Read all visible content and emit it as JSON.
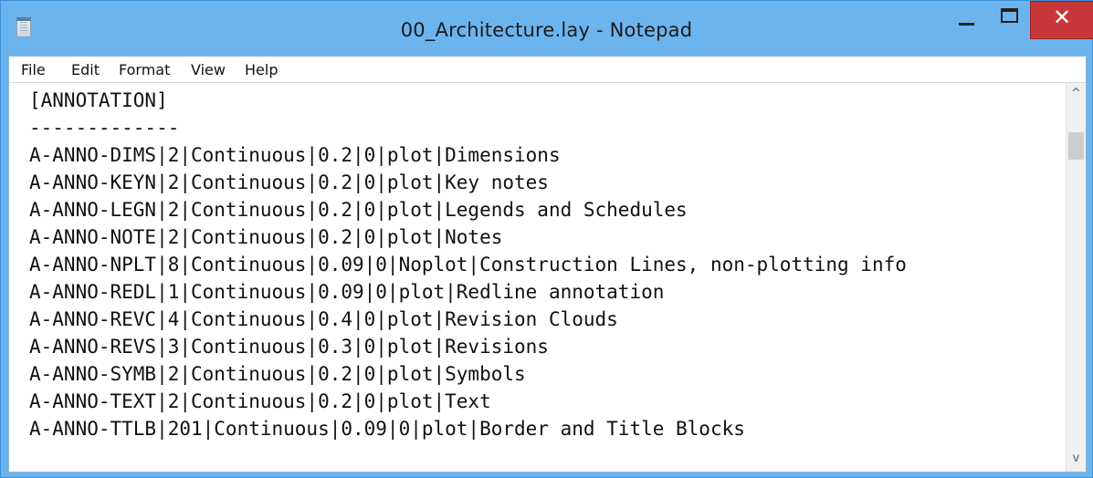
{
  "window": {
    "title": "00_Architecture.lay - Notepad",
    "close_glyph": "✕"
  },
  "menubar": {
    "items": [
      "File",
      "Edit",
      "Format",
      "View",
      "Help"
    ]
  },
  "editor": {
    "lines": [
      "[ANNOTATION]",
      "-------------",
      "A-ANNO-DIMS|2|Continuous|0.2|0|plot|Dimensions",
      "A-ANNO-KEYN|2|Continuous|0.2|0|plot|Key notes",
      "A-ANNO-LEGN|2|Continuous|0.2|0|plot|Legends and Schedules",
      "A-ANNO-NOTE|2|Continuous|0.2|0|plot|Notes",
      "A-ANNO-NPLT|8|Continuous|0.09|0|Noplot|Construction Lines, non-plotting info",
      "A-ANNO-REDL|1|Continuous|0.09|0|plot|Redline annotation",
      "A-ANNO-REVC|4|Continuous|0.4|0|plot|Revision Clouds",
      "A-ANNO-REVS|3|Continuous|0.3|0|plot|Revisions",
      "A-ANNO-SYMB|2|Continuous|0.2|0|plot|Symbols",
      "A-ANNO-TEXT|2|Continuous|0.2|0|plot|Text",
      "A-ANNO-TTLB|201|Continuous|0.09|0|plot|Border and Title Blocks"
    ]
  },
  "scrollbar": {
    "up_glyph": "^",
    "down_glyph": "v"
  },
  "icons": {
    "app": "notepad-icon",
    "minimize": "minimize-icon",
    "maximize": "maximize-icon",
    "close": "close-icon"
  },
  "colors": {
    "titlebar": "#6cb4ee",
    "close_button": "#c8383b",
    "text": "#111111",
    "background": "#ffffff"
  }
}
